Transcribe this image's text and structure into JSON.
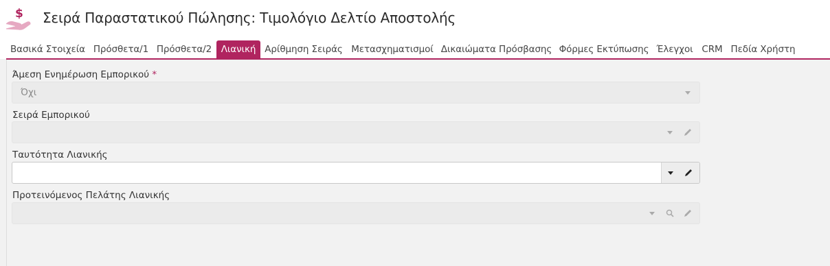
{
  "header": {
    "title": "Σειρά Παραστατικού Πώλησης: Τιμολόγιο Δελτίο Αποστολής",
    "icon": "hand-dollar-icon",
    "brand_color": "#b0245f"
  },
  "tabs": [
    {
      "label": "Βασικά Στοιχεία",
      "active": false
    },
    {
      "label": "Πρόσθετα/1",
      "active": false
    },
    {
      "label": "Πρόσθετα/2",
      "active": false
    },
    {
      "label": "Λιανική",
      "active": true
    },
    {
      "label": "Αρίθμηση Σειράς",
      "active": false
    },
    {
      "label": "Μετασχηματισμοί",
      "active": false
    },
    {
      "label": "Δικαιώματα Πρόσβασης",
      "active": false
    },
    {
      "label": "Φόρμες Εκτύπωσης",
      "active": false
    },
    {
      "label": "Έλεγχοι",
      "active": false
    },
    {
      "label": "CRM",
      "active": false
    },
    {
      "label": "Πεδία Χρήστη",
      "active": false
    }
  ],
  "form": {
    "fields": [
      {
        "label": "Άμεση Ενημέρωση Εμπορικού",
        "required_mark": "*",
        "value": "Όχι",
        "enabled": false
      },
      {
        "label": "Σειρά Εμπορικού",
        "value": "",
        "enabled": false
      },
      {
        "label": "Ταυτότητα Λιανικής",
        "value": "",
        "enabled": true
      },
      {
        "label": "Προτεινόμενος Πελάτης Λιανικής",
        "value": "",
        "enabled": false
      }
    ]
  }
}
